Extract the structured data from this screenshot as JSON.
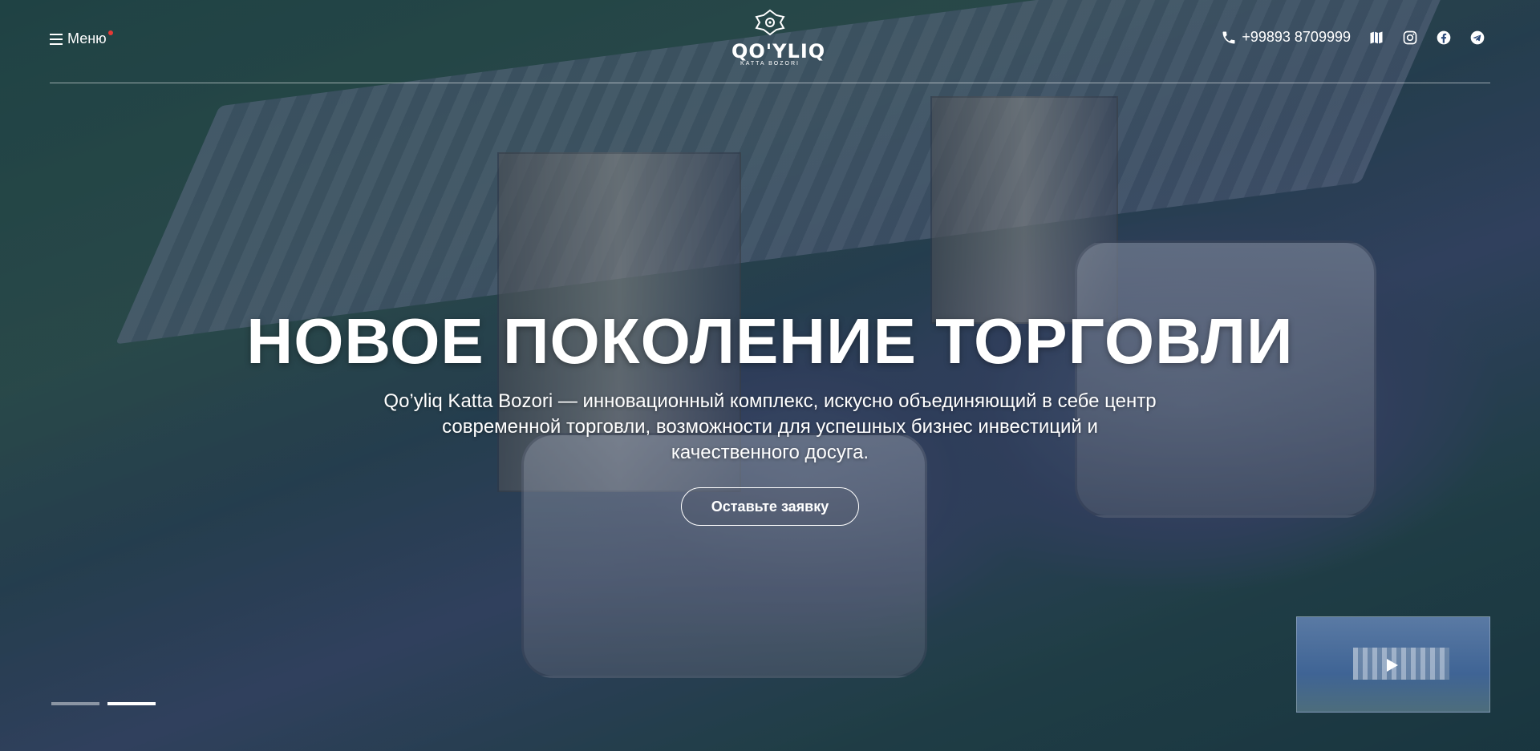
{
  "header": {
    "menu_label": "Меню",
    "logo": {
      "title": "QO'YLIQ",
      "subtitle": "KATTA BOZORI"
    },
    "phone": "+99893 8709999",
    "social_icons": [
      "map-icon",
      "instagram-icon",
      "facebook-icon",
      "telegram-icon"
    ]
  },
  "hero": {
    "title": "НОВОЕ ПОКОЛЕНИЕ ТОРГОВЛИ",
    "description": "Qo’yliq Katta Bozori — инновационный комплекс, искусно объединяющий в себе центр современной торговли, возможности для успешных бизнес инвестиций и качественного досуга.",
    "cta_label": "Оставьте заявку"
  },
  "slider": {
    "slides": 2,
    "active_index": 1
  },
  "colors": {
    "accent_dot": "#e53935",
    "overlay": "#142850"
  }
}
